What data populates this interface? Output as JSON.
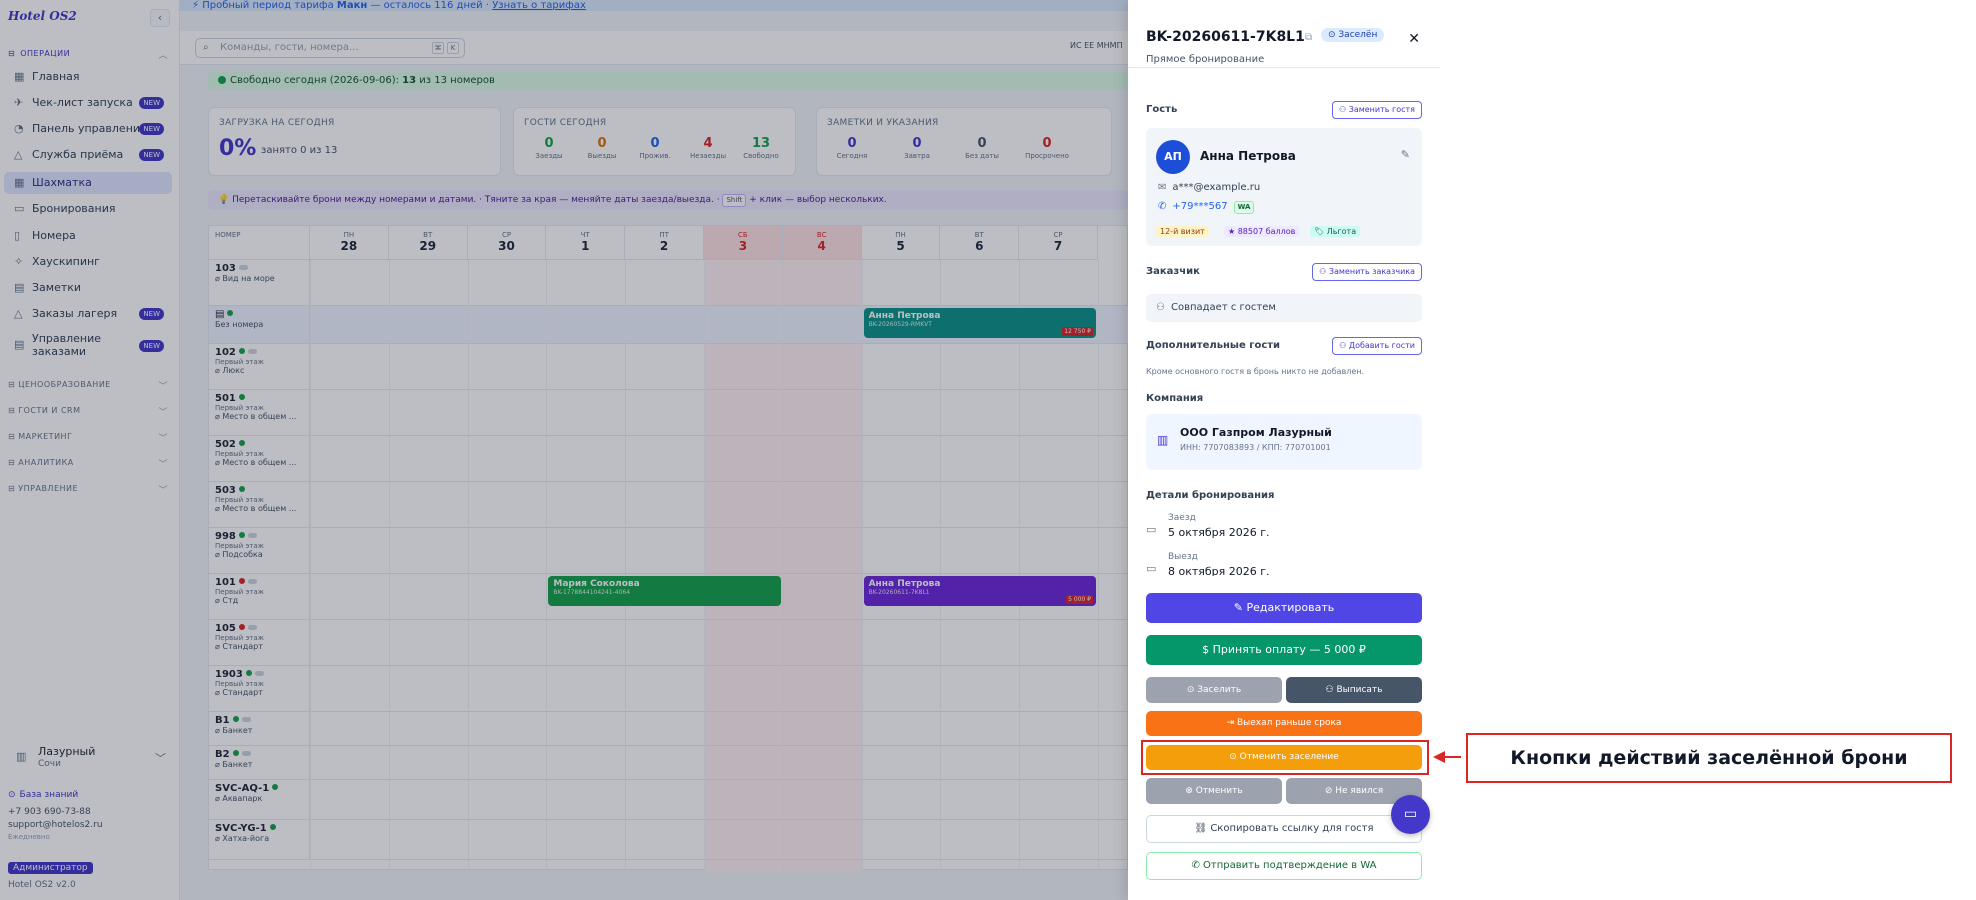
{
  "trial_bar": {
    "text_before": "Пробный период тарифа ",
    "plan": "Макн",
    "text_mid": " — осталось 116 дней · ",
    "link": "Узнать о тарифах"
  },
  "sidebar": {
    "brand": "Hotel OS2",
    "collapse_icon": "‹",
    "operations_label": "ОПЕРАЦИИ",
    "items": [
      {
        "label": "Главная",
        "icon": "grid-icon",
        "glyph": "▦",
        "new": false
      },
      {
        "label": "Чек-лист запуска",
        "icon": "rocket-icon",
        "glyph": "✈",
        "new": true
      },
      {
        "label": "Панель управления",
        "icon": "gauge-icon",
        "glyph": "◔",
        "new": true
      },
      {
        "label": "Служба приёма",
        "icon": "bell-icon",
        "glyph": "△",
        "new": true
      },
      {
        "label": "Шахматка",
        "icon": "calendar-grid-icon",
        "glyph": "▦",
        "new": false,
        "active": true
      },
      {
        "label": "Бронирования",
        "icon": "calendar-icon",
        "glyph": "▭",
        "new": false
      },
      {
        "label": "Номера",
        "icon": "door-icon",
        "glyph": "▯",
        "new": false
      },
      {
        "label": "Хаускипинг",
        "icon": "sparkle-icon",
        "glyph": "✧",
        "new": false
      },
      {
        "label": "Заметки",
        "icon": "note-icon",
        "glyph": "▤",
        "new": false
      },
      {
        "label": "Заказы лагеря",
        "icon": "tent-icon",
        "glyph": "△",
        "new": true
      },
      {
        "label": "Управление заказами",
        "icon": "orders-icon",
        "glyph": "▤",
        "new": true
      }
    ],
    "new_badge": "NEW",
    "sections": [
      "ЦЕНООБРАЗОВАНИЕ",
      "ГОСТИ И CRM",
      "МАРКЕТИНГ",
      "АНАЛИТИКА",
      "УПРАВЛЕНИЕ"
    ],
    "hotel_name": "Лазурный",
    "hotel_city": "Сочи",
    "knowledge_base": "База знаний",
    "phone": "+7 903 690-73-88",
    "email": "support@hotelos2.ru",
    "hours": "Ежедневно",
    "role": "Администратор",
    "version": "Hotel OS2 v2.0"
  },
  "topbar": {
    "search_placeholder": "Команды, гости, номера...",
    "kbd1": "⌘",
    "kbd2": "K",
    "lang": "ИС EE МНМП"
  },
  "free_bar": {
    "text": "Свободно сегодня (2026-09-06): ",
    "count": "13",
    "text_after": " из 13 номеров"
  },
  "cards": {
    "load": {
      "title": "ЗАГРУЗКА НА СЕГОДНЯ",
      "value": "0%",
      "sub": "занято 0 из 13"
    },
    "guests": {
      "title": "ГОСТИ СЕГОДНЯ",
      "stats": [
        {
          "value": "0",
          "label": "Заезды",
          "color": "#16a34a"
        },
        {
          "value": "0",
          "label": "Выезды",
          "color": "#d97706"
        },
        {
          "value": "0",
          "label": "Прожив.",
          "color": "#2563eb"
        },
        {
          "value": "4",
          "label": "Незаезды",
          "color": "#dc2626"
        },
        {
          "value": "13",
          "label": "Свободно",
          "color": "#16a34a"
        }
      ]
    },
    "notes": {
      "title": "ЗАМЕТКИ И УКАЗАНИЯ",
      "stats": [
        {
          "value": "0",
          "label": "Сегодня",
          "color": "#4338ca"
        },
        {
          "value": "0",
          "label": "Завтра",
          "color": "#4338ca"
        },
        {
          "value": "0",
          "label": "Без даты",
          "color": "#475569"
        },
        {
          "value": "0",
          "label": "Просрочено",
          "color": "#dc2626"
        }
      ]
    }
  },
  "hint": {
    "part1": "💡 Перетаскивайте брони между номерами и датами. · Тяните за края — меняйте даты заезда/выезда. · ",
    "kbd": "Shift",
    "part2": " + клик — выбор нескольких."
  },
  "grid": {
    "room_col": "НОМЕР",
    "days": [
      {
        "dow": "ПН",
        "num": "28",
        "we": false
      },
      {
        "dow": "ВТ",
        "num": "29",
        "we": false
      },
      {
        "dow": "СР",
        "num": "30",
        "we": false
      },
      {
        "dow": "ЧТ",
        "num": "1",
        "we": false
      },
      {
        "dow": "ПТ",
        "num": "2",
        "we": false
      },
      {
        "dow": "СБ",
        "num": "3",
        "we": true
      },
      {
        "dow": "ВС",
        "num": "4",
        "we": true
      },
      {
        "dow": "ПН",
        "num": "5",
        "we": false
      },
      {
        "dow": "ВТ",
        "num": "6",
        "we": false
      },
      {
        "dow": "СР",
        "num": "7",
        "we": false
      }
    ],
    "rows": [
      {
        "num": "103",
        "floor": "",
        "type": "Вид на море",
        "dot": "none",
        "pill": true
      },
      {
        "num": "",
        "floor": "",
        "type": "Без номера",
        "dot": "green",
        "pill": false,
        "unassigned": true
      },
      {
        "num": "102",
        "floor": "Первый этаж",
        "type": "Люкс",
        "dot": "green",
        "pill": true
      },
      {
        "num": "501",
        "floor": "Первый этаж",
        "type": "Место в общем ...",
        "dot": "green",
        "pill": false
      },
      {
        "num": "502",
        "floor": "Первый этаж",
        "type": "Место в общем ...",
        "dot": "green",
        "pill": false
      },
      {
        "num": "503",
        "floor": "Первый этаж",
        "type": "Место в общем ...",
        "dot": "green",
        "pill": false
      },
      {
        "num": "998",
        "floor": "Первый этаж",
        "type": "Подсобка",
        "dot": "green",
        "pill": true
      },
      {
        "num": "101",
        "floor": "Первый этаж",
        "type": "Стд",
        "dot": "red",
        "pill": true
      },
      {
        "num": "105",
        "floor": "Первый этаж",
        "type": "Стандарт",
        "dot": "red",
        "pill": true
      },
      {
        "num": "1903",
        "floor": "Первый этаж",
        "type": "Стандарт",
        "dot": "green",
        "pill": true
      },
      {
        "num": "B1",
        "floor": "",
        "type": "Банкет",
        "dot": "green",
        "pill": true
      },
      {
        "num": "B2",
        "floor": "",
        "type": "Банкет",
        "dot": "green",
        "pill": true
      },
      {
        "num": "SVC-AQ-1",
        "floor": "",
        "type": "Аквапарк",
        "dot": "green",
        "pill": false
      },
      {
        "num": "SVC-YG-1",
        "floor": "",
        "type": "Хатха-йога",
        "dot": "green",
        "pill": false
      }
    ],
    "bookings": [
      {
        "guest": "Анна Петрова",
        "number": "BK-20260529-RMKVT",
        "amount": "12 750 ₽",
        "color": "#0d9488",
        "row": 1,
        "start": 7,
        "span": 3
      },
      {
        "guest": "Мария Соколова",
        "number": "BK-1778844104241-4064",
        "amount": "",
        "color": "#16a34a",
        "row": 7,
        "start": 3,
        "span": 3
      },
      {
        "guest": "Анна Петрова",
        "number": "BK-20260611-7K8L1",
        "amount": "5 000 ₽",
        "color": "#6d28d9",
        "row": 7,
        "start": 7,
        "span": 3
      }
    ]
  },
  "drawer": {
    "title": "BK-20260611-7K8L1",
    "status": "Заселён",
    "source": "Прямое бронирование",
    "guest_section": "Гость",
    "replace_guest": "Заменить гостя",
    "initials": "АП",
    "guest_name": "Анна Петрова",
    "guest_email": "a***@example.ru",
    "guest_phone": "+79***567",
    "wa_badge": "WA",
    "tags": [
      {
        "text": "12-й визит",
        "bg": "#fef3c7",
        "fg": "#92400e"
      },
      {
        "text": "★ 88507 баллов",
        "bg": "#ede9fe",
        "fg": "#5b21b6"
      },
      {
        "text": "🏷 Льгота",
        "bg": "#ccfbf1",
        "fg": "#115e59"
      }
    ],
    "customer_section": "Заказчик",
    "replace_customer": "Заменить заказчика",
    "customer_same": "Совпадает с гостем",
    "extra_section": "Дополнительные гости",
    "add_guest": "Добавить гости",
    "extra_note": "Кроме основного гостя в бронь никто не добавлен.",
    "company_section": "Компания",
    "company_name": "ООО Газпром Лазурный",
    "company_inn": "ИНН: 7707083893 / КПП: 770701001",
    "details_section": "Детали бронирования",
    "checkin_label": "Заезд",
    "checkin_value": "5 октября 2026 г.",
    "checkout_label": "Выезд",
    "checkout_value": "8 октября 2026 г.",
    "actions": {
      "edit": "Редактировать",
      "pay": "Принять оплату — 5 000 ₽",
      "checkin": "Заселить",
      "checkout": "Выписать",
      "early": "Выехал раньше срока",
      "cancel_checkin": "Отменить заселение",
      "cancel": "Отменить",
      "noshow": "Не явился",
      "copy_link": "Скопировать ссылку для гостя",
      "send_wa": "Отправить подтверждение в WA"
    }
  },
  "annotation": {
    "label": "Кнопки действий заселённой брони"
  }
}
